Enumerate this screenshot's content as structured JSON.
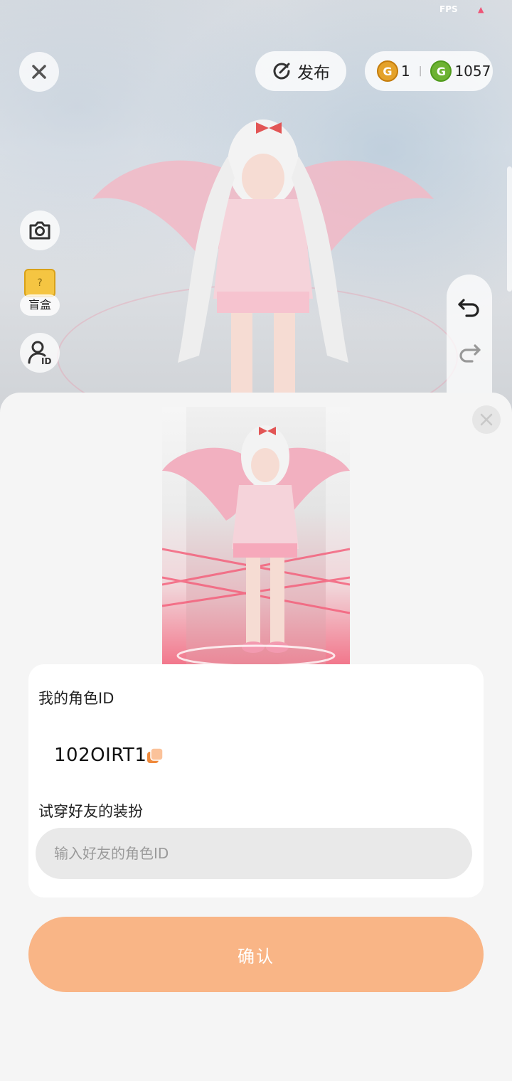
{
  "status": {
    "fps_label": "FPS"
  },
  "topbar": {
    "publish_label": "发布",
    "currency": [
      {
        "icon": "gold-coin-icon",
        "amount": "1",
        "color": "#e4a22a"
      },
      {
        "icon": "green-coin-icon",
        "amount": "1057",
        "color": "#6db232"
      }
    ]
  },
  "side_tools": {
    "blindbox_label": "盲盒"
  },
  "sheet": {
    "my_id_label": "我的角色ID",
    "my_id_value": "102OIRT1",
    "try_on_label": "试穿好友的装扮",
    "friend_id_placeholder": "输入好友的角色ID",
    "confirm_label": "确认"
  },
  "colors": {
    "accent": "#f9b586",
    "copy": "#f08a3c"
  }
}
